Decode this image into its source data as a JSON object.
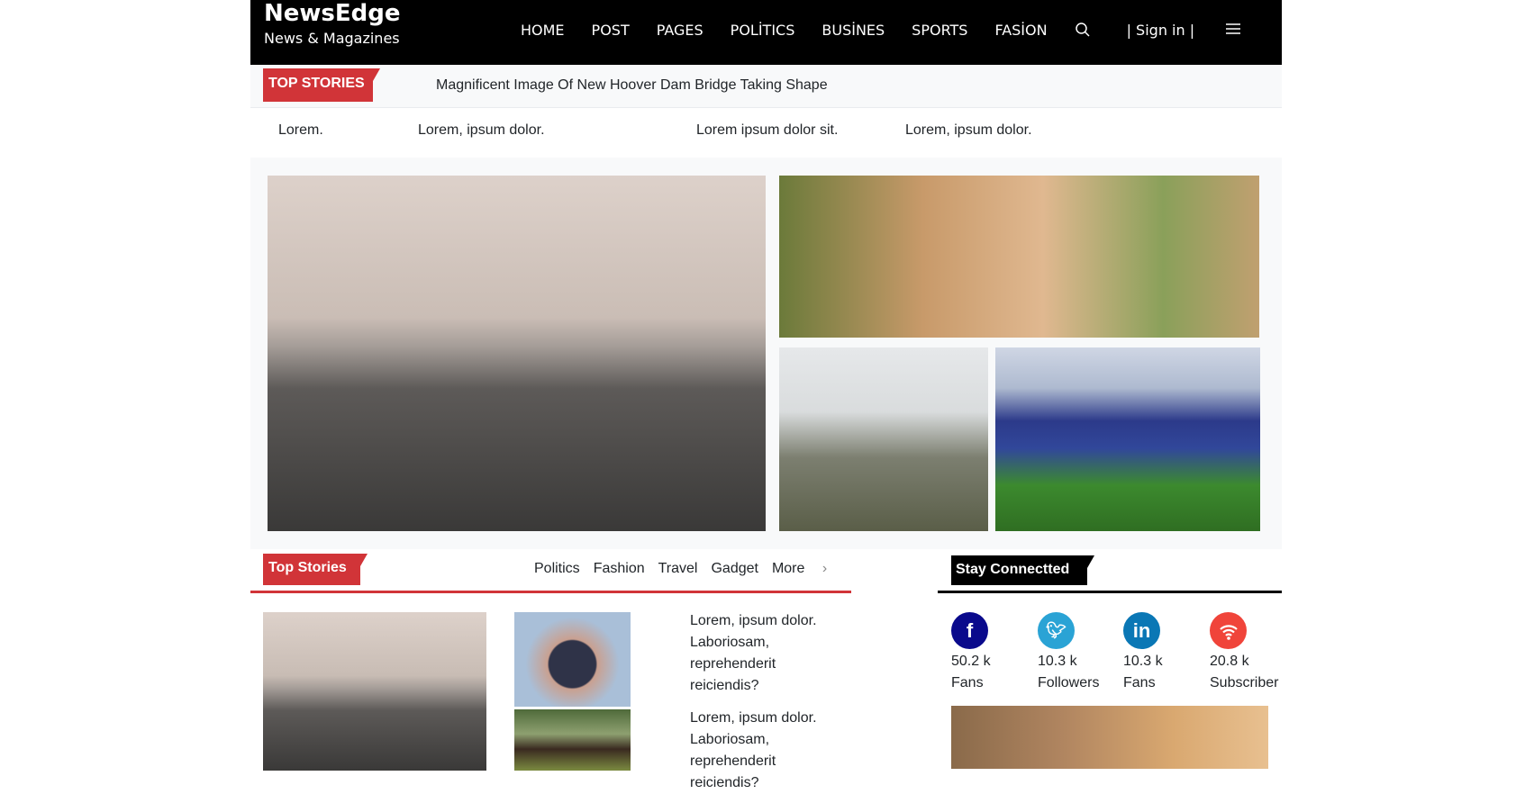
{
  "header": {
    "logo": "NewsEdge",
    "tagline": "News & Magazines",
    "nav": [
      "HOME",
      "POST",
      "PAGES",
      "POLİTICS",
      "BUSİNES",
      "SPORTS",
      "FASİON"
    ],
    "sign_in": "| Sign in |"
  },
  "ticker": {
    "label": "TOP STORIES",
    "headline": "Magnificent Image Of New Hoover Dam Bridge Taking Shape"
  },
  "links": [
    "Lorem.",
    "Lorem, ipsum dolor.",
    "Lorem ipsum dolor sit.",
    "Lorem, ipsum dolor."
  ],
  "top_stories": {
    "label": "Top Stories",
    "tabs": [
      "Politics",
      "Fashion",
      "Travel",
      "Gadget"
    ],
    "more": "More",
    "articles": [
      "Lorem, ipsum dolor. Laboriosam, reprehenderit reiciendis?",
      "Lorem, ipsum dolor. Laboriosam, reprehenderit reiciendis?"
    ]
  },
  "stay_connected": {
    "label": "Stay Connectted",
    "items": [
      {
        "icon": "facebook-icon",
        "count": "50.2 k",
        "unit": "Fans",
        "color": "#0a0a8c"
      },
      {
        "icon": "twitter-icon",
        "count": "10.3 k",
        "unit": "Followers",
        "color": "#2aa3d5"
      },
      {
        "icon": "linkedin-icon",
        "count": "10.3 k",
        "unit": "Fans",
        "color": "#0a77b5"
      },
      {
        "icon": "rss-icon",
        "count": "20.8 k",
        "unit": "Subscriber",
        "color": "#f0443a"
      }
    ]
  }
}
